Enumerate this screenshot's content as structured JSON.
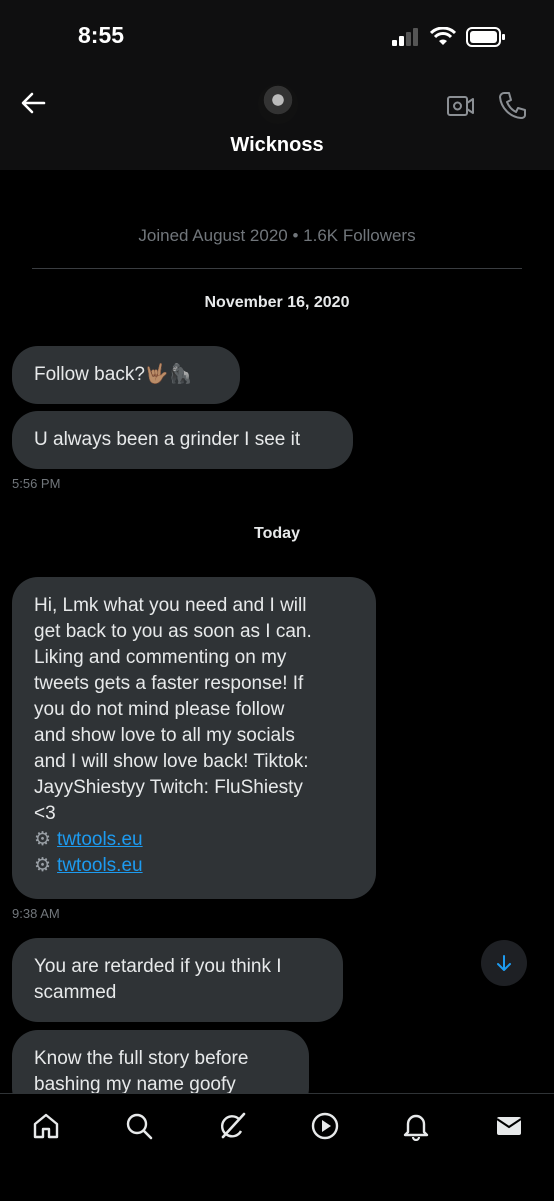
{
  "status_bar": {
    "time": "8:55"
  },
  "header": {
    "name": "Wicknoss"
  },
  "profile": {
    "joined_text": "Joined August 2020 • 1.6K Followers"
  },
  "conversation": {
    "sections": [
      {
        "date": "November 16, 2020",
        "messages": [
          {
            "text": "Follow back?🤟🏽🦍"
          },
          {
            "text": "U always been a grinder I see it"
          }
        ],
        "time": "5:56 PM"
      },
      {
        "date": "Today",
        "messages": [
          {
            "lines": [
              "Hi, Lmk what you need and I will",
              "get back to you as soon as I can.",
              "Liking and commenting on my",
              "tweets gets a faster response! If",
              "you do not mind please follow",
              "and show love to all my socials",
              "and I will show love back! Tiktok:",
              "JayyShiestyy Twitch: FluShiesty",
              "<3"
            ],
            "links": [
              "twtools.eu",
              "twtools.eu"
            ]
          }
        ],
        "time": "9:38 AM"
      }
    ],
    "later_messages": [
      {
        "lines": [
          "You are retarded if you think I",
          "scammed"
        ]
      },
      {
        "lines": [
          "Know the full story before",
          "bashing my name goofy"
        ]
      }
    ]
  },
  "icons": {
    "back": "arrow-left-icon",
    "video": "video-camera-icon",
    "phone": "phone-icon",
    "scroll": "arrow-down-icon",
    "tabs": [
      "home-icon",
      "search-icon",
      "grok-icon",
      "play-icon",
      "bell-icon",
      "mail-icon"
    ]
  },
  "colors": {
    "background": "#000000",
    "bubble": "#2f3336",
    "link": "#1d9bf0",
    "muted": "#71767b",
    "text": "#e7e9ea"
  }
}
